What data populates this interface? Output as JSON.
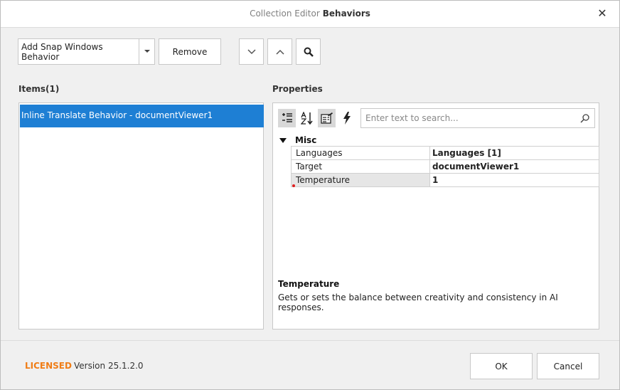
{
  "window": {
    "title_prefix": "Collection Editor",
    "title_main": "Behaviors",
    "close_glyph": "✕"
  },
  "toolbar": {
    "add_label": "Add Snap Windows Behavior",
    "remove_label": "Remove",
    "icons": [
      "chevron-down-icon",
      "chevron-up-icon",
      "search-icon"
    ]
  },
  "items": {
    "header": "Items(1)",
    "list": [
      {
        "label": "Inline Translate Behavior - documentViewer1",
        "selected": true
      }
    ]
  },
  "properties": {
    "header": "Properties",
    "toolbar_icons": [
      "categorized-icon",
      "alphabetical-icon",
      "properties-icon",
      "events-icon"
    ],
    "search_placeholder": "Enter text to search...",
    "category": "Misc",
    "rows": [
      {
        "name": "Languages",
        "value": "Languages [1]"
      },
      {
        "name": "Target",
        "value": "documentViewer1"
      },
      {
        "name": "Temperature",
        "value": "1",
        "selected": true
      }
    ],
    "description_title": "Temperature",
    "description_text": "Gets or sets the balance between creativity and consistency in AI responses."
  },
  "footer": {
    "licensed": "LICENSED",
    "version": "Version 25.1.2.0",
    "ok_label": "OK",
    "cancel_label": "Cancel"
  },
  "colors": {
    "selection": "#1e7fd4",
    "licensed": "#f07d16",
    "modified_marker": "#e02020"
  }
}
